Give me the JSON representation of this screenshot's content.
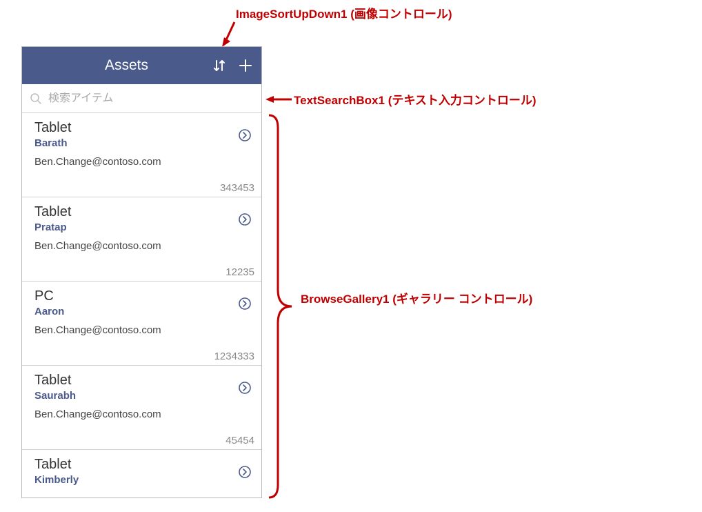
{
  "annotations": {
    "top": "ImageSortUpDown1 (画像コントロール)",
    "search": "TextSearchBox1 (テキスト入力コントロール)",
    "gallery": "BrowseGallery1 (ギャラリー コントロール)"
  },
  "header": {
    "title": "Assets"
  },
  "search": {
    "placeholder": "検索アイテム"
  },
  "items": [
    {
      "title": "Tablet",
      "name": "Barath",
      "email": "Ben.Change@contoso.com",
      "number": "343453"
    },
    {
      "title": "Tablet",
      "name": "Pratap",
      "email": "Ben.Change@contoso.com",
      "number": "12235"
    },
    {
      "title": "PC",
      "name": "Aaron",
      "email": "Ben.Change@contoso.com",
      "number": "1234333"
    },
    {
      "title": "Tablet",
      "name": "Saurabh",
      "email": "Ben.Change@contoso.com",
      "number": "45454"
    },
    {
      "title": "Tablet",
      "name": "Kimberly",
      "email": "",
      "number": ""
    }
  ],
  "colors": {
    "headerBg": "#4a5b8b",
    "link": "#4a5b8b",
    "annotation": "#c00000"
  }
}
